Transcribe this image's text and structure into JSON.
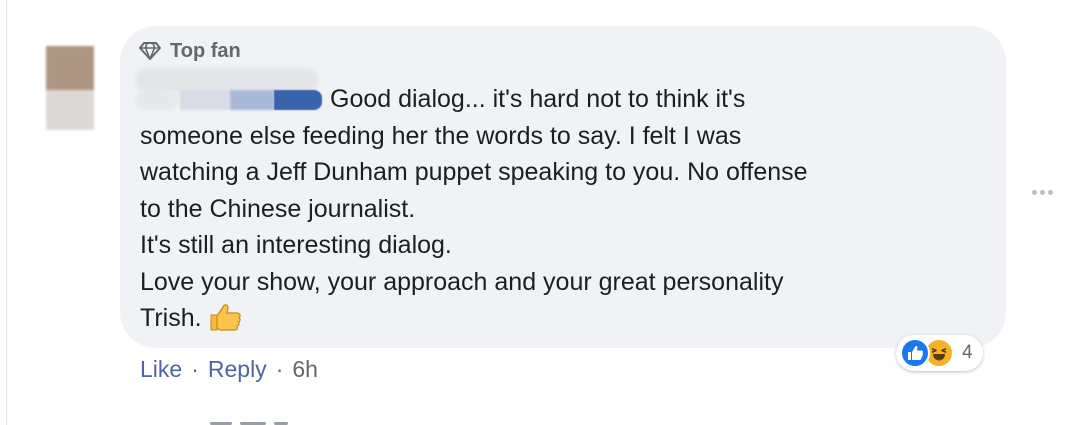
{
  "comment": {
    "badge": {
      "icon": "diamond-icon",
      "label": "Top fan"
    },
    "lines": [
      "Good dialog... it's hard not to think it's",
      "someone else feeding her the words to say. I felt I was",
      "watching a Jeff Dunham puppet speaking to you. No offense",
      "to the Chinese journalist.",
      "It's still an interesting dialog.",
      "Love your show, your approach and your great personality",
      "Trish."
    ],
    "emoji": "thumbs-up-icon",
    "reactions": {
      "icons": [
        "like-reaction-icon",
        "haha-reaction-icon"
      ],
      "count": "4"
    },
    "actions": {
      "like": "Like",
      "separator": "·",
      "reply": "Reply",
      "time": "6h"
    }
  },
  "colors": {
    "bubble": "#f0f2f5",
    "text": "#1c1e21",
    "muted": "#65676b",
    "link": "#4f66a3",
    "like_blue": "#1877f2",
    "haha_yellow": "#f7b125"
  }
}
